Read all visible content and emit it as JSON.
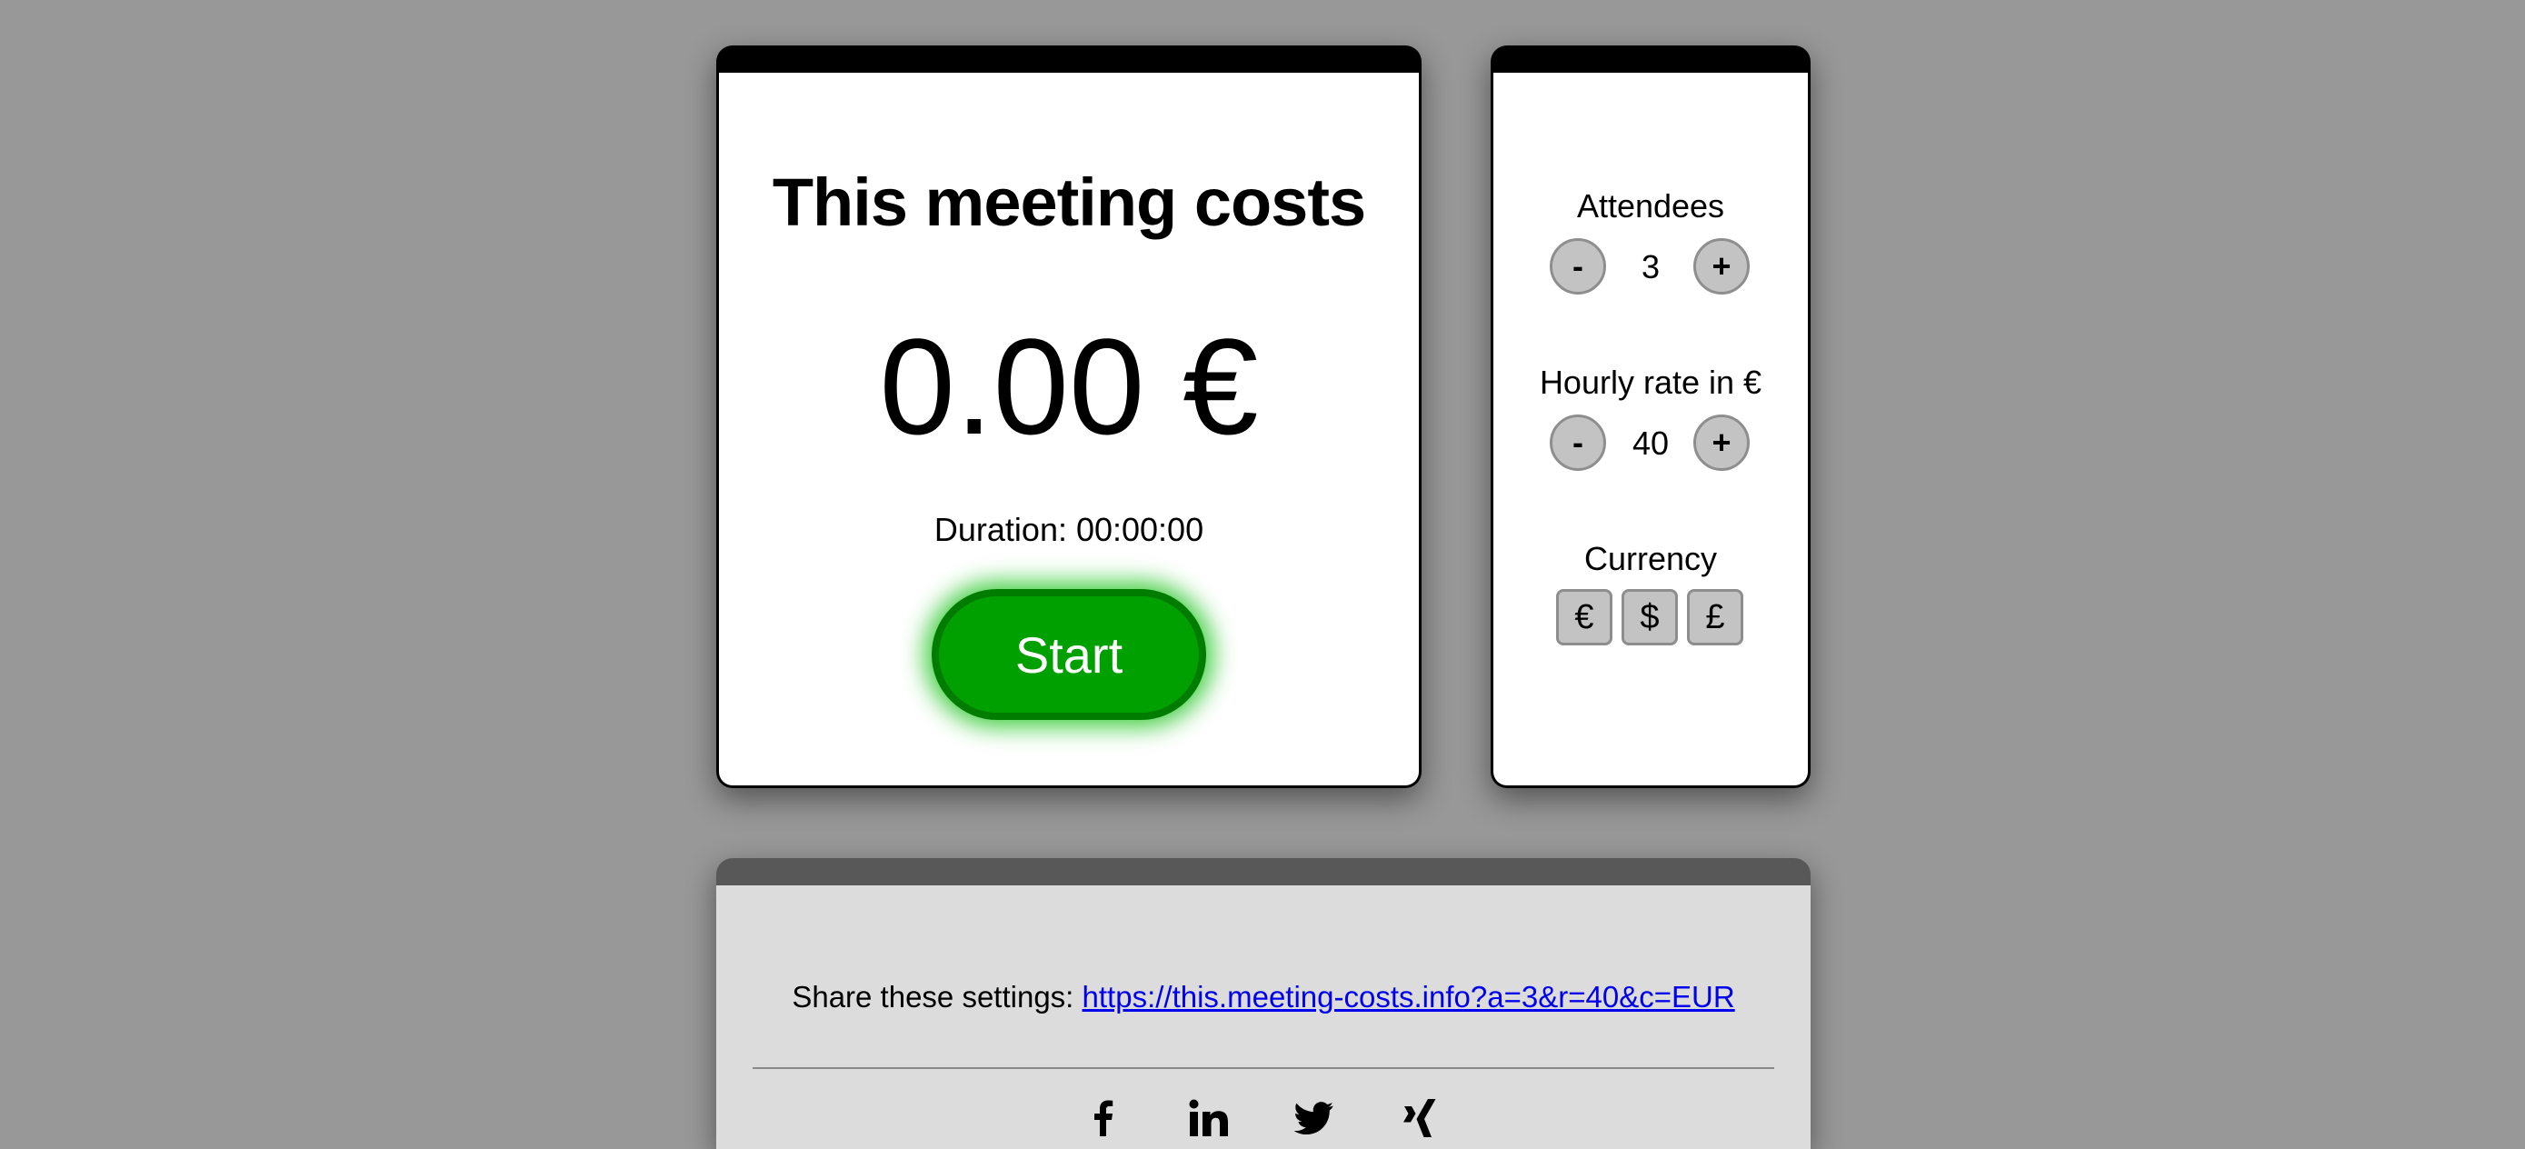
{
  "main": {
    "title": "This meeting costs",
    "cost": "0.00 €",
    "duration": "Duration: 00:00:00",
    "start_label": "Start"
  },
  "settings": {
    "attendees": {
      "label": "Attendees",
      "decrement": "-",
      "value": "3",
      "increment": "+"
    },
    "hourly_rate": {
      "label": "Hourly rate in €",
      "decrement": "-",
      "value": "40",
      "increment": "+"
    },
    "currency": {
      "label": "Currency",
      "options": [
        "€",
        "$",
        "£"
      ]
    }
  },
  "share": {
    "label": "Share these settings: ",
    "url": "https://this.meeting-costs.info?a=3&r=40&c=EUR",
    "social": [
      "facebook-icon",
      "linkedin-icon",
      "twitter-icon",
      "xing-icon"
    ]
  },
  "colors": {
    "background": "#989898",
    "start_button": "#00a000",
    "link": "#0000ee",
    "share_panel": "#dcdcdc"
  }
}
